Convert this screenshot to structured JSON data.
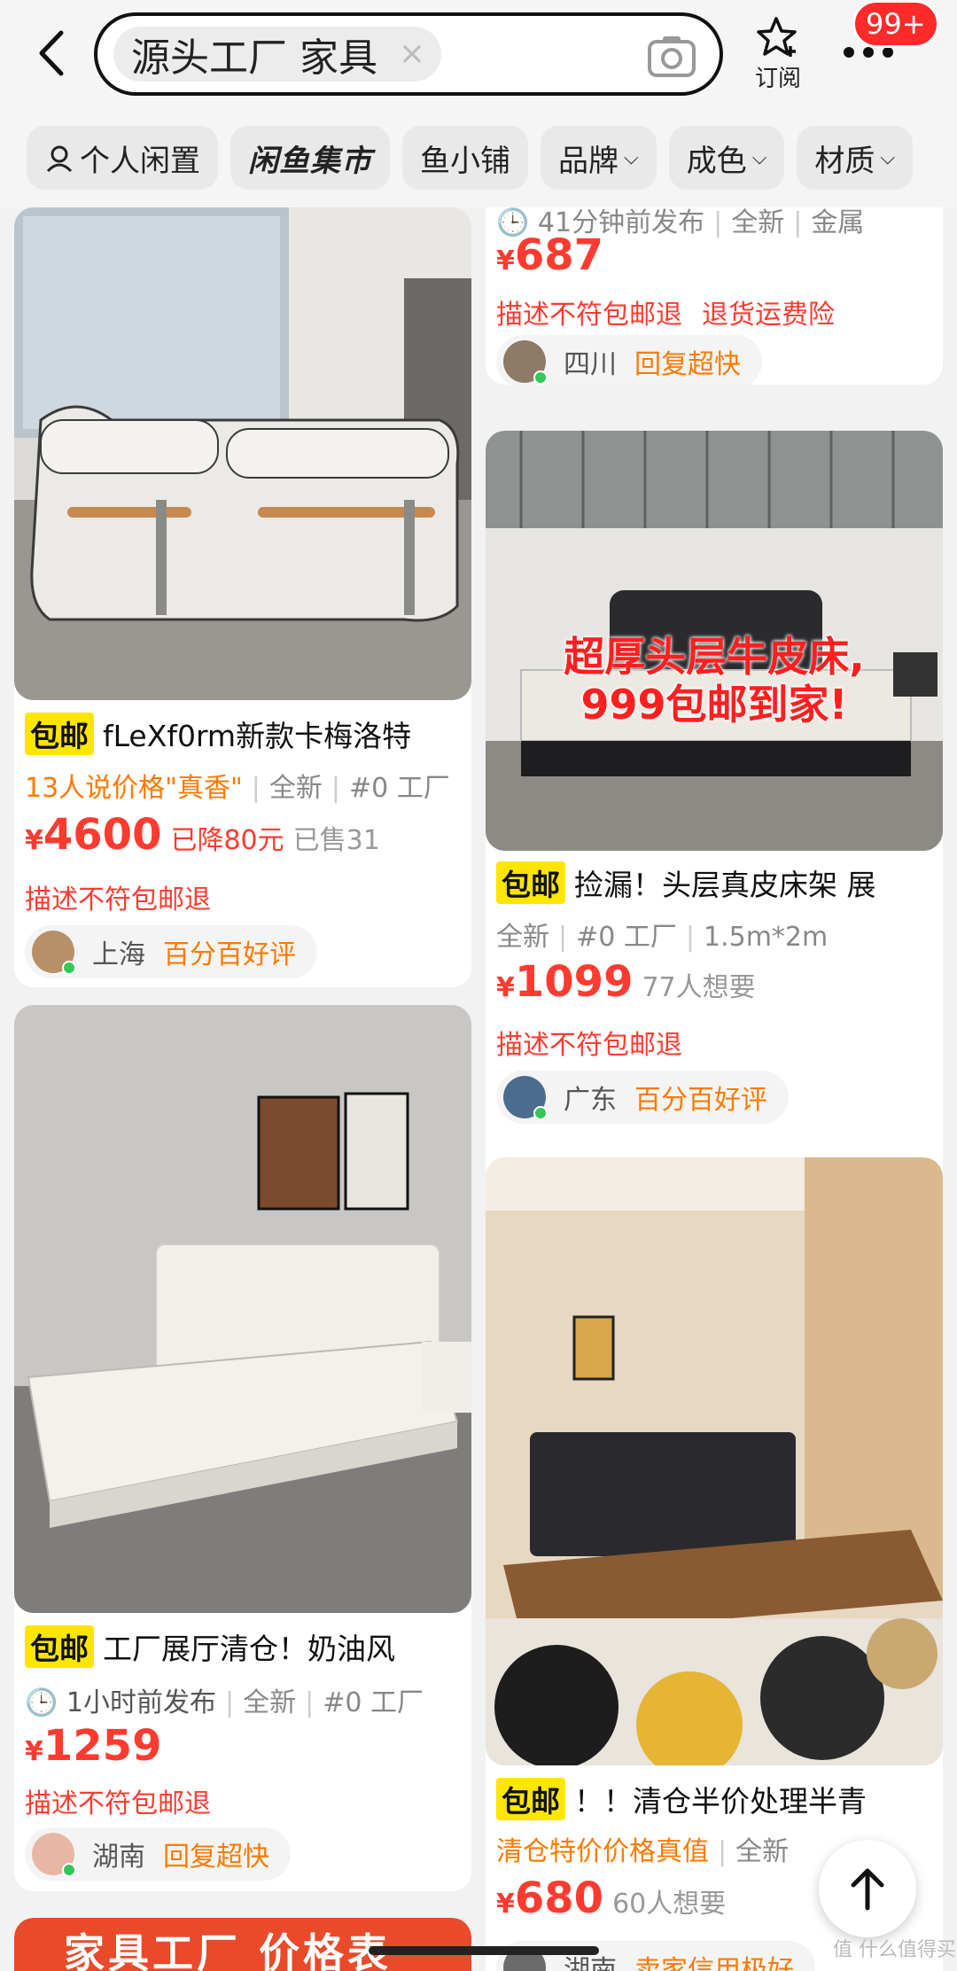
{
  "search": {
    "keyword": "源头工厂 家具",
    "clear": "×"
  },
  "header": {
    "subscribe_label": "订阅",
    "badge": "99+"
  },
  "filters": [
    {
      "label": "个人闲置"
    },
    {
      "label": "闲鱼集市"
    },
    {
      "label": "鱼小铺"
    },
    {
      "label": "品牌"
    },
    {
      "label": "成色"
    },
    {
      "label": "材质"
    }
  ],
  "cards": {
    "c1": {
      "baoyou": "包邮",
      "title": "fLeXf0rm新款卡梅洛特",
      "meta_hl": "13人说价格\"真香\"",
      "meta_cond": "全新",
      "meta_tag": "#0 工厂",
      "yen": "¥",
      "price": "4600",
      "drop": "已降80元",
      "sold": "已售31",
      "tag1": "描述不符包邮退",
      "loc": "上海",
      "seller_note": "百分百好评"
    },
    "c2": {
      "time": "41分钟前发布",
      "meta_cond": "全新",
      "meta_tag": "金属",
      "yen": "¥",
      "price": "687",
      "tag1": "描述不符包邮退",
      "tag2": "退货运费险",
      "loc": "四川",
      "seller_note": "回复超快"
    },
    "c3": {
      "overlay_line1": "超厚头层牛皮床,",
      "overlay_line2": "999包邮到家!",
      "baoyou": "包邮",
      "title": "捡漏！头层真皮床架 展",
      "meta_cond": "全新",
      "meta_tag": "#0 工厂",
      "meta_size": "1.5m*2m",
      "yen": "¥",
      "price": "1099",
      "wants": "77人想要",
      "tag1": "描述不符包邮退",
      "loc": "广东",
      "seller_note": "百分百好评"
    },
    "c4": {
      "baoyou": "包邮",
      "title": "工厂展厅清仓！奶油风",
      "time": "1小时前发布",
      "meta_cond": "全新",
      "meta_tag": "#0 工厂",
      "yen": "¥",
      "price": "1259",
      "tag1": "描述不符包邮退",
      "loc": "湖南",
      "seller_note": "回复超快"
    },
    "c5": {
      "baoyou": "包邮",
      "title": "！！清仓半价处理半青",
      "meta_hl": "清仓特价价格真值",
      "meta_cond": "全新",
      "yen": "¥",
      "price": "680",
      "wants": "60人想要",
      "loc": "湖南",
      "seller_note": "卖家信用极好"
    },
    "c6": {
      "banner": "家具工厂 价格表"
    }
  },
  "watermark": "值 什么值得买",
  "colors": {
    "accent_red": "#ff3b30",
    "accent_orange": "#ff7a00",
    "baoyou_yellow": "#ffe600",
    "online_green": "#34c759"
  }
}
